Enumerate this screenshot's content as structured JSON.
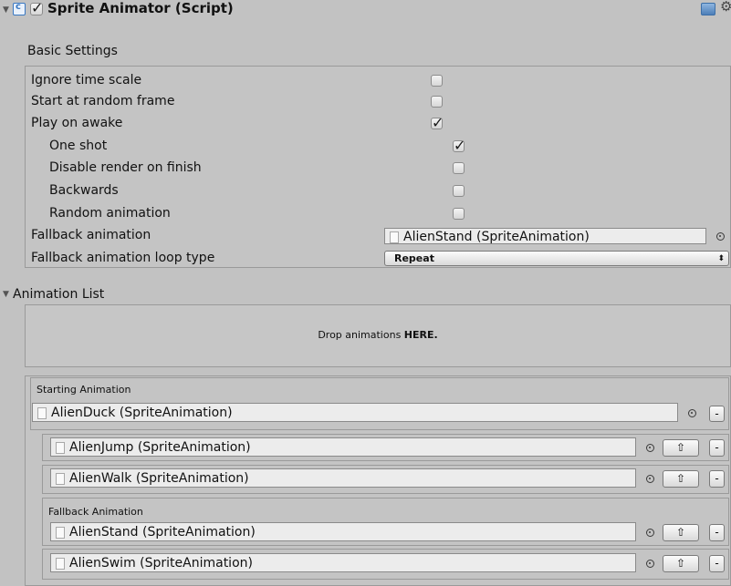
{
  "header": {
    "title": "Sprite Animator (Script)",
    "enabled_checked": true,
    "icons": [
      "script-icon",
      "book-icon",
      "gear-icon"
    ]
  },
  "basic_settings": {
    "section_label": "Basic Settings",
    "ignore_time_scale": {
      "label": "Ignore time scale",
      "checked": false
    },
    "start_at_random_frame": {
      "label": "Start at random frame",
      "checked": false
    },
    "play_on_awake": {
      "label": "Play on awake",
      "checked": true
    },
    "one_shot": {
      "label": "One shot",
      "checked": true
    },
    "disable_render_on_finish": {
      "label": "Disable render on finish",
      "checked": false
    },
    "backwards": {
      "label": "Backwards",
      "checked": false
    },
    "random_animation": {
      "label": "Random animation",
      "checked": false
    },
    "fallback_animation": {
      "label": "Fallback animation",
      "value": "AlienStand (SpriteAnimation)"
    },
    "fallback_loop_type": {
      "label": "Fallback animation loop type",
      "value": "Repeat"
    }
  },
  "animation_list": {
    "label": "Animation List",
    "drop_text_prefix": "Drop animations ",
    "drop_text_bold": "HERE.",
    "starting_label": "Starting Animation",
    "starting_value": "AlienDuck (SpriteAnimation)",
    "fallback_label": "Fallback Animation",
    "items": [
      {
        "value": "AlienJump (SpriteAnimation)"
      },
      {
        "value": "AlienWalk (SpriteAnimation)"
      },
      {
        "value": "AlienStand (SpriteAnimation)"
      },
      {
        "value": "AlienSwim (SpriteAnimation)"
      }
    ],
    "move_up_glyph": "⇧",
    "remove_glyph": "-"
  },
  "colors": {
    "background": "#c2c2c2",
    "panel": "#c4c4c4",
    "field": "#ececec"
  }
}
